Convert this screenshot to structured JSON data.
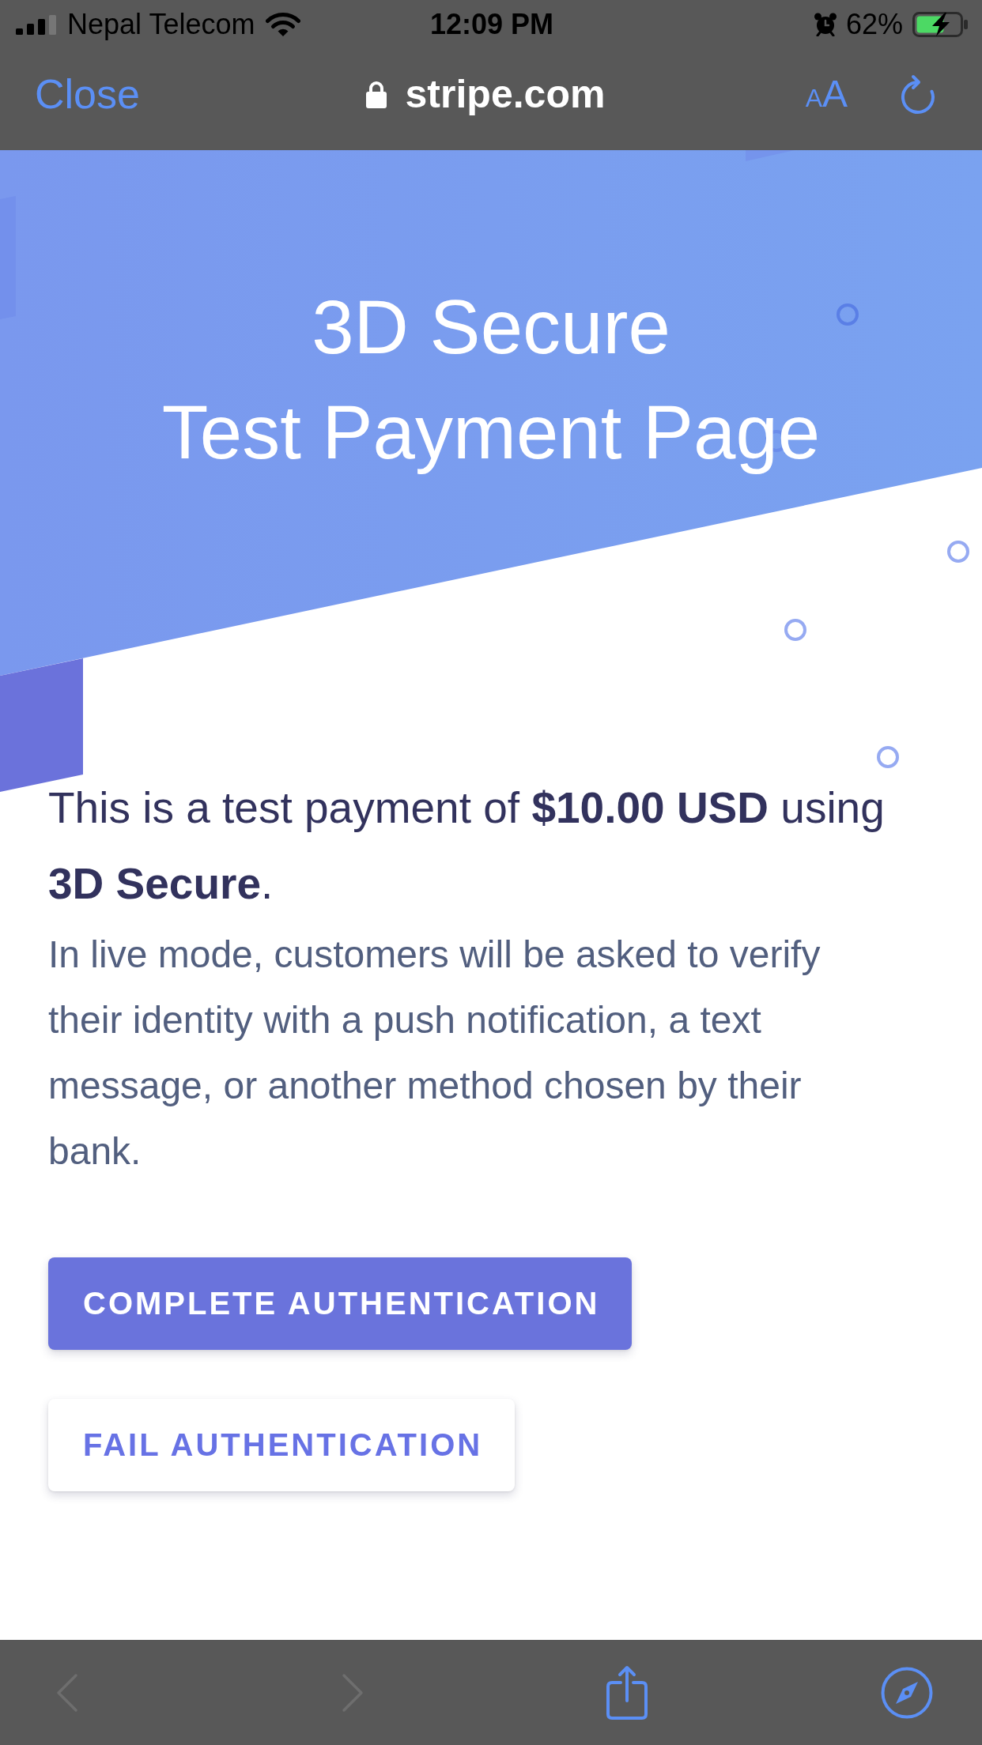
{
  "status_bar": {
    "carrier": "Nepal Telecom",
    "time": "12:09 PM",
    "battery": "62%"
  },
  "browser_bar": {
    "close": "Close",
    "url": "stripe.com",
    "text_size": [
      "A",
      "A"
    ]
  },
  "page": {
    "title": [
      "3D Secure",
      "Test Payment Page"
    ],
    "summary": "This is a test payment of **$10.00 USD** using **3D Secure**.",
    "description": "In live mode, customers will be asked to verify their identity with a push notification, a text message, or another method chosen by their bank.",
    "buttons": [
      {
        "label": "COMPLETE AUTHENTICATION",
        "kind": "primary"
      },
      {
        "label": "FAIL AUTHENTICATION",
        "kind": "secondary"
      }
    ]
  },
  "toolbar": [
    {
      "kind": "back",
      "disabled": true
    },
    {
      "kind": "forward",
      "disabled": true
    },
    {
      "kind": "share",
      "disabled": false
    },
    {
      "kind": "compass",
      "disabled": false
    }
  ]
}
